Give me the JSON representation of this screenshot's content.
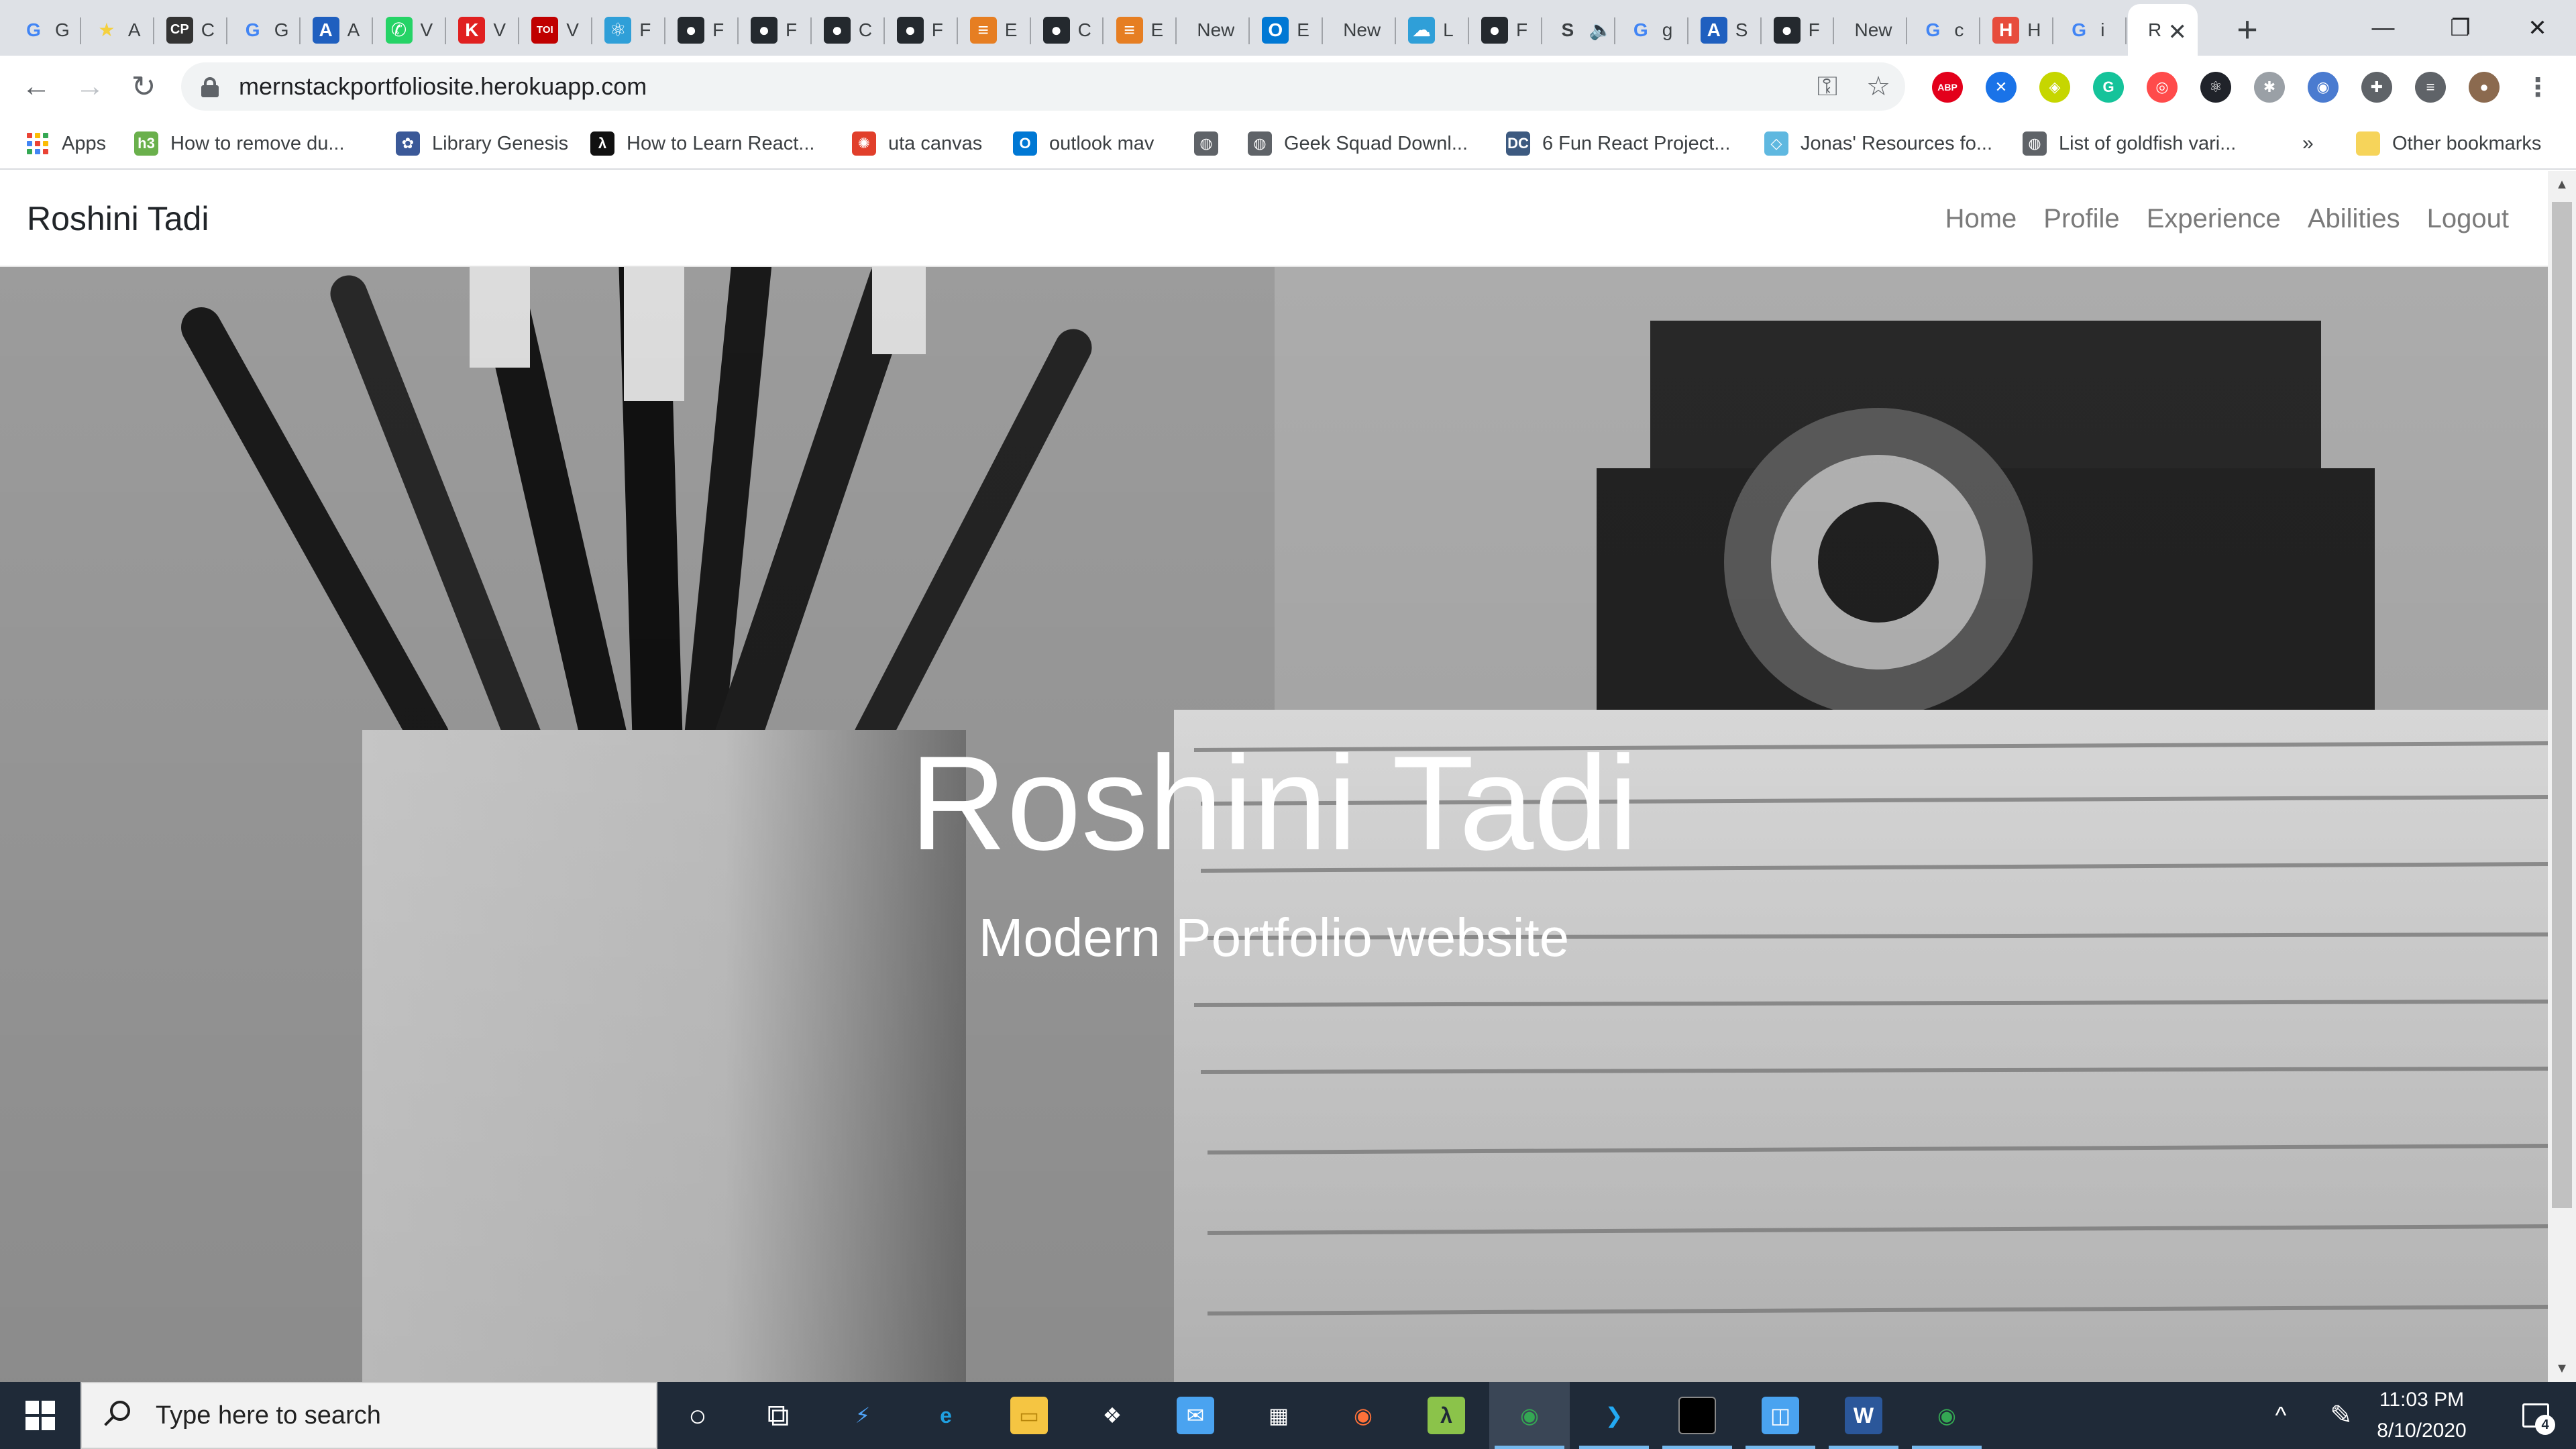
{
  "browser": {
    "tabs": [
      {
        "icon": "google-icon",
        "glyph": "G",
        "label": "G",
        "color": "#4285f4"
      },
      {
        "icon": "star-icon",
        "glyph": "★",
        "label": "A",
        "color": "#f4d03f"
      },
      {
        "icon": "cp-icon",
        "glyph": "CP",
        "label": "C",
        "color": "#333333"
      },
      {
        "icon": "google-icon",
        "glyph": "G",
        "label": "G",
        "color": "#4285f4"
      },
      {
        "icon": "azure-icon",
        "glyph": "A",
        "label": "A",
        "color": "#1f5fbf"
      },
      {
        "icon": "whatsapp-icon",
        "glyph": "✆",
        "label": "V",
        "color": "#25d366"
      },
      {
        "icon": "k-icon",
        "glyph": "K",
        "label": "V",
        "color": "#e02020"
      },
      {
        "icon": "toi-icon",
        "glyph": "TOI",
        "label": "V",
        "color": "#c00000"
      },
      {
        "icon": "react-icon",
        "glyph": "⚛",
        "label": "F",
        "color": "#2f9fd8"
      },
      {
        "icon": "github-icon",
        "glyph": "●",
        "label": "F",
        "color": "#24292e"
      },
      {
        "icon": "github-icon",
        "glyph": "●",
        "label": "F",
        "color": "#24292e"
      },
      {
        "icon": "github-icon",
        "glyph": "●",
        "label": "C",
        "color": "#24292e"
      },
      {
        "icon": "github-icon",
        "glyph": "●",
        "label": "F",
        "color": "#24292e"
      },
      {
        "icon": "burger-icon",
        "glyph": "≡",
        "label": "E",
        "color": "#e67e22"
      },
      {
        "icon": "github-icon",
        "glyph": "●",
        "label": "C",
        "color": "#24292e"
      },
      {
        "icon": "burger-icon",
        "glyph": "≡",
        "label": "E",
        "color": "#e67e22"
      },
      {
        "icon": "none",
        "glyph": "",
        "label": "New",
        "color": "#dee1e6"
      },
      {
        "icon": "outlook-icon",
        "glyph": "O",
        "label": "E",
        "color": "#0078d4"
      },
      {
        "icon": "none",
        "glyph": "",
        "label": "New",
        "color": "#dee1e6"
      },
      {
        "icon": "cloud-icon",
        "glyph": "☁",
        "label": "L",
        "color": "#2f9fd8"
      },
      {
        "icon": "github-icon",
        "glyph": "●",
        "label": "F",
        "color": "#24292e"
      },
      {
        "icon": "speaker-icon",
        "glyph": "S",
        "label": "🔈",
        "color": "#dee1e6"
      },
      {
        "icon": "google-icon",
        "glyph": "G",
        "label": "g",
        "color": "#4285f4"
      },
      {
        "icon": "azure-icon",
        "glyph": "A",
        "label": "S",
        "color": "#1f5fbf"
      },
      {
        "icon": "github-icon",
        "glyph": "●",
        "label": "F",
        "color": "#24292e"
      },
      {
        "icon": "none",
        "glyph": "",
        "label": "New",
        "color": "#dee1e6"
      },
      {
        "icon": "google-icon",
        "glyph": "G",
        "label": "c",
        "color": "#4285f4"
      },
      {
        "icon": "h-icon",
        "glyph": "H",
        "label": "H",
        "color": "#e74c3c"
      },
      {
        "icon": "google-icon",
        "glyph": "G",
        "label": "i",
        "color": "#4285f4"
      }
    ],
    "active_tab": {
      "label": "R",
      "close": "✕"
    },
    "new_tab": "+",
    "window": {
      "minimize": "—",
      "maximize": "❐",
      "close": "✕"
    },
    "nav": {
      "back": "←",
      "forward": "→",
      "reload": "↻"
    },
    "url": "mernstackportfoliosite.herokuapp.com",
    "omnibox_icons": {
      "key": "⚿",
      "star": "☆"
    },
    "extensions": [
      {
        "name": "adblock-plus-icon",
        "glyph": "ABP",
        "color": "#e3001b"
      },
      {
        "name": "x-extension-icon",
        "glyph": "✕",
        "color": "#1a73e8"
      },
      {
        "name": "tag-extension-icon",
        "glyph": "◈",
        "color": "#c6d600"
      },
      {
        "name": "grammarly-icon",
        "glyph": "G",
        "color": "#15c39a"
      },
      {
        "name": "lens-extension-icon",
        "glyph": "◎",
        "color": "#ff4b4b"
      },
      {
        "name": "react-devtools-icon",
        "glyph": "⚛",
        "color": "#20232a"
      },
      {
        "name": "bug-extension-icon",
        "glyph": "✱",
        "color": "#9aa0a6"
      },
      {
        "name": "camera-extension-icon",
        "glyph": "◉",
        "color": "#4a7bd0"
      },
      {
        "name": "puzzle-icon",
        "glyph": "✚",
        "color": "#5f6368"
      },
      {
        "name": "media-control-icon",
        "glyph": "≡",
        "color": "#5f6368"
      },
      {
        "name": "profile-avatar",
        "glyph": "●",
        "color": "#8b6a4f"
      },
      {
        "name": "menu-icon",
        "glyph": "⋮",
        "color": "#ffffff"
      }
    ]
  },
  "bookmarks": {
    "items": [
      {
        "name": "bookmark-apps",
        "label": "Apps",
        "icon": "apps-grid-icon",
        "color": "#4285f4"
      },
      {
        "name": "bookmark-remove-du",
        "label": "How to remove du...",
        "icon": "h3-icon",
        "glyph": "h3",
        "color": "#6ab04c"
      },
      {
        "name": "bookmark-library-genesis",
        "label": "Library Genesis",
        "icon": "libgen-icon",
        "glyph": "✿",
        "color": "#3b5998"
      },
      {
        "name": "bookmark-learn-react",
        "label": "How to Learn React...",
        "icon": "react-icon",
        "glyph": "λ",
        "color": "#111111"
      },
      {
        "name": "bookmark-uta-canvas",
        "label": "uta canvas",
        "icon": "canvas-icon",
        "glyph": "✺",
        "color": "#e13f2b"
      },
      {
        "name": "bookmark-outlook-mav",
        "label": "outlook mav",
        "icon": "outlook-icon",
        "glyph": "O",
        "color": "#0078d4"
      },
      {
        "name": "bookmark-globe",
        "label": "",
        "icon": "globe-icon",
        "glyph": "◍",
        "color": "#5f6368"
      },
      {
        "name": "bookmark-geek-squad",
        "label": "Geek Squad Downl...",
        "icon": "globe-icon",
        "glyph": "◍",
        "color": "#5f6368"
      },
      {
        "name": "bookmark-react-projects",
        "label": "6 Fun React Project...",
        "icon": "dc-icon",
        "glyph": "DC",
        "color": "#3d5a80"
      },
      {
        "name": "bookmark-jonas-resources",
        "label": "Jonas' Resources fo...",
        "icon": "diamond-icon",
        "glyph": "◇",
        "color": "#5fb8e0"
      },
      {
        "name": "bookmark-goldfish",
        "label": "List of goldfish vari...",
        "icon": "globe-icon",
        "glyph": "◍",
        "color": "#5f6368"
      }
    ],
    "overflow": "»",
    "other": "Other bookmarks"
  },
  "site": {
    "brand": "Roshini Tadi",
    "nav": [
      "Home",
      "Profile",
      "Experience",
      "Abilities",
      "Logout"
    ],
    "hero_title": "Roshini Tadi",
    "hero_subtitle": "Modern Portfolio website"
  },
  "taskbar": {
    "search_placeholder": "Type here to search",
    "apps": [
      {
        "name": "cortana-icon",
        "glyph": "○"
      },
      {
        "name": "task-view-icon",
        "glyph": "⧉"
      },
      {
        "name": "visual-studio-icon",
        "glyph": "⚡",
        "color": "#4fa3f7"
      },
      {
        "name": "edge-icon",
        "glyph": "e",
        "color": "#1fa0e0"
      },
      {
        "name": "file-explorer-icon",
        "glyph": "▭",
        "color": "#f5c542"
      },
      {
        "name": "dropbox-icon",
        "glyph": "❖",
        "color": "#ffffff"
      },
      {
        "name": "mail-icon",
        "glyph": "✉",
        "color": "#4aa3f0"
      },
      {
        "name": "store-icon",
        "glyph": "▦",
        "color": "#ffffff"
      },
      {
        "name": "firefox-icon",
        "glyph": "◉",
        "color": "#ff7139"
      },
      {
        "name": "lambda-app-icon",
        "glyph": "λ",
        "color": "#8bc34a"
      },
      {
        "name": "chrome-icon",
        "glyph": "◉",
        "color": "#34a853"
      },
      {
        "name": "vscode-icon",
        "glyph": "❯",
        "color": "#23a9f2"
      },
      {
        "name": "terminal-icon",
        "glyph": "▬",
        "color": "#000000"
      },
      {
        "name": "windows-app-icon",
        "glyph": "◫",
        "color": "#4aa3f0"
      },
      {
        "name": "word-icon",
        "glyph": "W",
        "color": "#2b579a"
      },
      {
        "name": "chrome-icon",
        "glyph": "◉",
        "color": "#34a853"
      }
    ],
    "tray": {
      "chevron": "^",
      "pen": "✎"
    },
    "time": "11:03 PM",
    "date": "8/10/2020",
    "notifications": "4"
  }
}
